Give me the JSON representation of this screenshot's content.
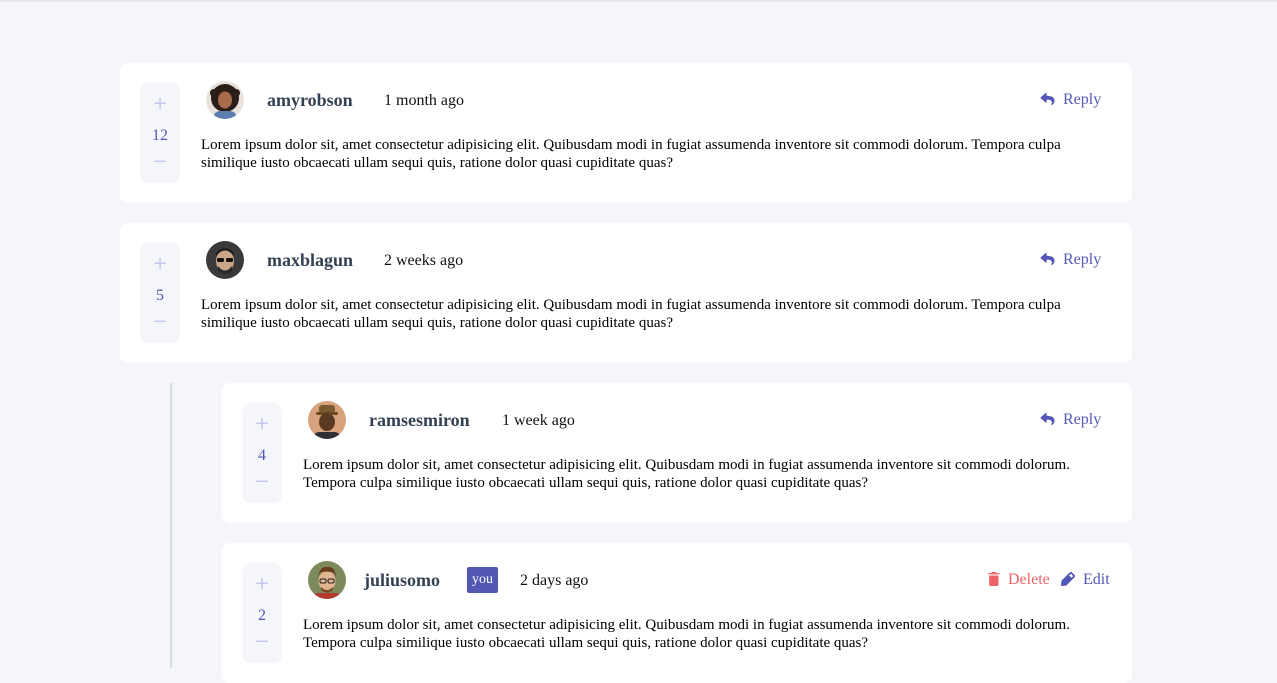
{
  "comments": [
    {
      "username": "amyrobson",
      "created_at": "1 month ago",
      "score": "12",
      "content": "Lorem ipsum dolor sit, amet consectetur adipisicing elit. Quibusdam modi in fugiat assumenda inventore sit commodi dolorum. Tempora culpa similique iusto obcaecati ullam sequi quis, ratione dolor quasi cupiditate quas?",
      "reply_label": "Reply"
    },
    {
      "username": "maxblagun",
      "created_at": "2 weeks ago",
      "score": "5",
      "content": "Lorem ipsum dolor sit, amet consectetur adipisicing elit. Quibusdam modi in fugiat assumenda inventore sit commodi dolorum. Tempora culpa similique iusto obcaecati ullam sequi quis, ratione dolor quasi cupiditate quas?",
      "reply_label": "Reply",
      "replies": [
        {
          "username": "ramsesmiron",
          "created_at": "1 week ago",
          "score": "4",
          "content": "Lorem ipsum dolor sit, amet consectetur adipisicing elit. Quibusdam modi in fugiat assumenda inventore sit commodi dolorum. Tempora culpa similique iusto obcaecati ullam sequi quis, ratione dolor quasi cupiditate quas?",
          "reply_label": "Reply"
        },
        {
          "username": "juliusomo",
          "you_badge": "you",
          "created_at": "2 days ago",
          "score": "2",
          "content": "Lorem ipsum dolor sit, amet consectetur adipisicing elit. Quibusdam modi in fugiat assumenda inventore sit commodi dolorum. Tempora culpa similique iusto obcaecati ullam sequi quis, ratione dolor quasi cupiditate quas?",
          "delete_label": "Delete",
          "edit_label": "Edit"
        }
      ]
    }
  ],
  "icons": {
    "plus": "+",
    "minus": "−"
  },
  "colors": {
    "accent": "#5357b6",
    "danger": "#ed6368",
    "vote_icon": "#c5c6ef",
    "username": "#334253",
    "background": "#f5f6fa"
  }
}
